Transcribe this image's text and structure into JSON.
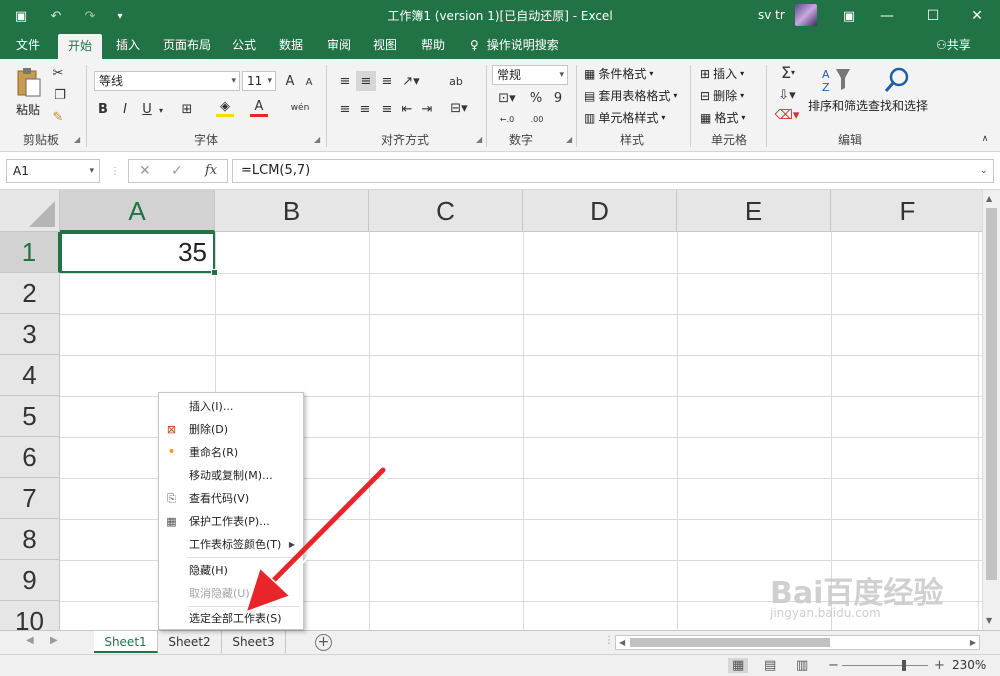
{
  "titlebar": {
    "title": "工作簿1 (version 1)[已自动还原]  -  Excel",
    "user": "sv tr",
    "minimize": "—",
    "maximize": "☐",
    "close": "✕",
    "ribbon_display_icon": "▣"
  },
  "quick_access": {
    "save": "▣",
    "undo": "↶",
    "redo": "↷",
    "customize": "▾"
  },
  "tabs": [
    "文件",
    "开始",
    "插入",
    "页面布局",
    "公式",
    "数据",
    "审阅",
    "视图",
    "帮助"
  ],
  "active_tab": "开始",
  "tellme": "操作说明搜索",
  "share": "共享",
  "ribbon": {
    "clipboard": {
      "label": "剪贴板",
      "paste": "粘贴"
    },
    "font": {
      "label": "字体",
      "font_name": "等线",
      "font_size": "11",
      "bold": "B",
      "italic": "I",
      "underline": "U",
      "grow": "A",
      "shrink": "A",
      "phonetic": "wén"
    },
    "alignment": {
      "label": "对齐方式",
      "wrap": "ab"
    },
    "number": {
      "label": "数字",
      "format": "常规",
      "percent": "%",
      "comma": "9",
      "inc_dec": "←.0",
      "dec_dec": ".00"
    },
    "styles": {
      "label": "样式",
      "conditional": "条件格式",
      "table": "套用表格格式",
      "cell_styles": "单元格样式"
    },
    "cells": {
      "label": "单元格",
      "insert": "插入",
      "delete": "删除",
      "format": "格式"
    },
    "editing": {
      "label": "编辑",
      "sort_filter": "排序和筛选",
      "find_select": "查找和选择",
      "sum": "Σ"
    }
  },
  "formula_bar": {
    "name_box": "A1",
    "cancel": "✕",
    "enter": "✓",
    "fx": "fx",
    "formula": "=LCM(5,7)"
  },
  "grid": {
    "columns": [
      "A",
      "B",
      "C",
      "D",
      "E",
      "F"
    ],
    "rows": [
      "1",
      "2",
      "3",
      "4",
      "5",
      "6",
      "7",
      "8",
      "9",
      "10"
    ],
    "cell_a1": "35"
  },
  "context_menu": {
    "items": [
      {
        "label": "插入(I)...",
        "disabled": false
      },
      {
        "label": "删除(D)",
        "disabled": false
      },
      {
        "label": "重命名(R)",
        "disabled": false
      },
      {
        "label": "移动或复制(M)...",
        "disabled": false
      },
      {
        "label": "查看代码(V)",
        "disabled": false
      },
      {
        "label": "保护工作表(P)...",
        "disabled": false
      },
      {
        "label": "工作表标签颜色(T)",
        "disabled": false
      },
      {
        "label": "隐藏(H)",
        "disabled": false
      },
      {
        "label": "取消隐藏(U)...",
        "disabled": true
      },
      {
        "label": "选定全部工作表(S)",
        "disabled": false
      }
    ]
  },
  "sheets": [
    "Sheet1",
    "Sheet2",
    "Sheet3"
  ],
  "active_sheet": "Sheet1",
  "status": {
    "zoom": "230%"
  },
  "watermark": {
    "brand": "Bai百度经验",
    "url": "jingyan.baidu.com"
  },
  "colors": {
    "excel_green": "#217346",
    "arrow_red": "#e8262a"
  }
}
